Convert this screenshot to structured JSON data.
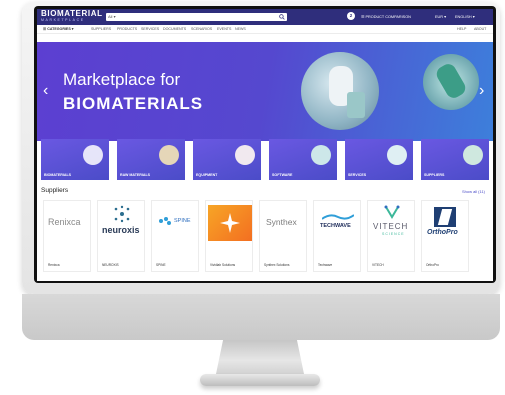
{
  "header": {
    "logo_main": "BIOMATERIAL",
    "logo_sub": "MARKETPLACE",
    "search_category": "All",
    "notification_count": "2",
    "product_comparison": "PRODUCT COMPARISON",
    "currency": "EUR",
    "language": "ENGLISH"
  },
  "nav": {
    "categories": "CATEGORIES",
    "items": [
      "SUPPLIERS",
      "PRODUCTS",
      "SERVICES",
      "DOCUMENTS",
      "SCENARIOS",
      "EVENTS",
      "NEWS"
    ],
    "right": [
      "HELP",
      "ABOUT"
    ]
  },
  "hero": {
    "line1": "Marketplace for",
    "line2": "BIOMATERIALS"
  },
  "categories": [
    {
      "label": "BIOMATERIALS"
    },
    {
      "label": "RAW MATERIALS"
    },
    {
      "label": "EQUIPMENT"
    },
    {
      "label": "SOFTWARE"
    },
    {
      "label": "SERVICES"
    },
    {
      "label": "SUPPLIERS"
    }
  ],
  "suppliers_section": {
    "title": "Suppliers",
    "show_all": "Show all (11)"
  },
  "suppliers": [
    {
      "name": "Renixca",
      "logo_text": "Renixca"
    },
    {
      "name": "NEUROXIS",
      "logo_text": "neuroxis"
    },
    {
      "name": "SPINE",
      "logo_text": "SPINE"
    },
    {
      "name": "Vividlab Solutions",
      "logo_text": ""
    },
    {
      "name": "Synthex Solutions",
      "logo_text": "Synthex"
    },
    {
      "name": "Techwave",
      "logo_text": "TECHWAVE"
    },
    {
      "name": "VITECH",
      "logo_text": "VITECH",
      "logo_sub": "SCIENCE"
    },
    {
      "name": "OrthoPro",
      "logo_text": "OrthoPro"
    }
  ]
}
